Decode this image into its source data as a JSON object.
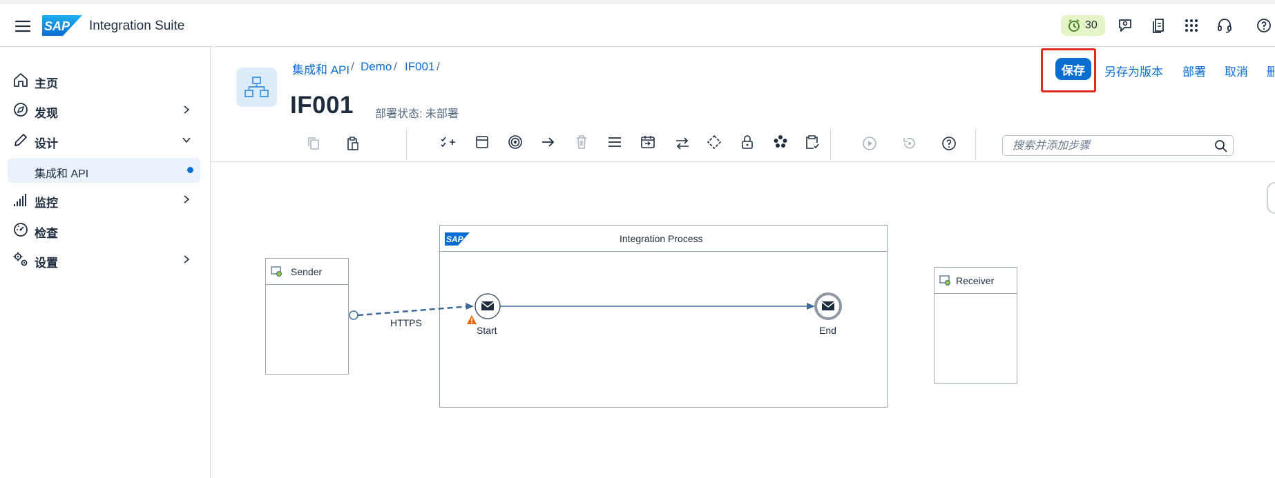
{
  "shell": {
    "logo_text": "SAP",
    "app_title": "Integration Suite",
    "badge_count": "30"
  },
  "sidenav": {
    "items": [
      {
        "label": "主页"
      },
      {
        "label": "发现"
      },
      {
        "label": "设计"
      },
      {
        "label": "监控"
      },
      {
        "label": "检查"
      },
      {
        "label": "设置"
      }
    ],
    "sub_item": "集成和 API"
  },
  "header": {
    "breadcrumb": [
      "集成和 API",
      "Demo",
      "IF001"
    ],
    "title": "IF001",
    "status": "部署状态: 未部署",
    "actions": {
      "save": "保存",
      "save_as_version": "另存为版本",
      "deploy": "部署",
      "cancel": "取消",
      "cut_off": "删"
    }
  },
  "toolbar": {
    "search_placeholder": "搜索并添加步骤"
  },
  "canvas": {
    "sender": "Sender",
    "receiver": "Receiver",
    "process_title": "Integration Process",
    "process_logo": "SAP",
    "connection_label": "HTTPS",
    "start_label": "Start",
    "end_label": "End"
  },
  "colors": {
    "accent": "#0a6ed1",
    "highlight": "#e02b20",
    "badge_bg": "#e5f5c8",
    "warning": "#e76500"
  }
}
